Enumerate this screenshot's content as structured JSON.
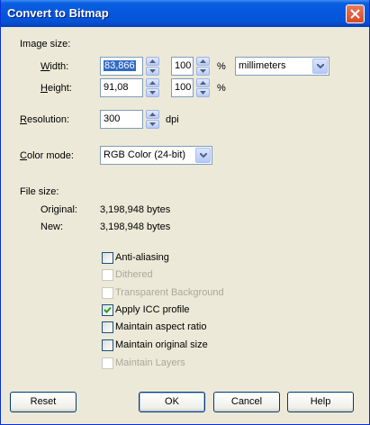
{
  "window": {
    "title": "Convert to Bitmap"
  },
  "image_size": {
    "section_label": "Image size:",
    "width_label": "Width:",
    "width_value": "83,866",
    "width_percent": "100",
    "height_label": "Height:",
    "height_value": "91,08",
    "height_percent": "100",
    "percent_symbol": "%",
    "units": "millimeters"
  },
  "resolution": {
    "label": "Resolution:",
    "value": "300",
    "unit": "dpi"
  },
  "color_mode": {
    "label": "Color mode:",
    "value": "RGB Color (24-bit)"
  },
  "file_size": {
    "section_label": "File size:",
    "original_label": "Original:",
    "original_value": "3,198,948 bytes",
    "new_label": "New:",
    "new_value": "3,198,948 bytes"
  },
  "options": [
    {
      "label": "Anti-aliasing",
      "checked": false,
      "enabled": true
    },
    {
      "label": "Dithered",
      "checked": false,
      "enabled": false
    },
    {
      "label": "Transparent Background",
      "checked": false,
      "enabled": false
    },
    {
      "label": "Apply ICC profile",
      "checked": true,
      "enabled": true
    },
    {
      "label": "Maintain aspect ratio",
      "checked": false,
      "enabled": true
    },
    {
      "label": "Maintain original size",
      "checked": false,
      "enabled": true
    },
    {
      "label": "Maintain Layers",
      "checked": false,
      "enabled": false
    }
  ],
  "buttons": {
    "reset": "Reset",
    "ok": "OK",
    "cancel": "Cancel",
    "help": "Help"
  },
  "colors": {
    "titlebar": "#0556dc",
    "dialog_bg": "#ece9d8",
    "selection": "#316ac5",
    "disabled_text": "#aca899"
  }
}
